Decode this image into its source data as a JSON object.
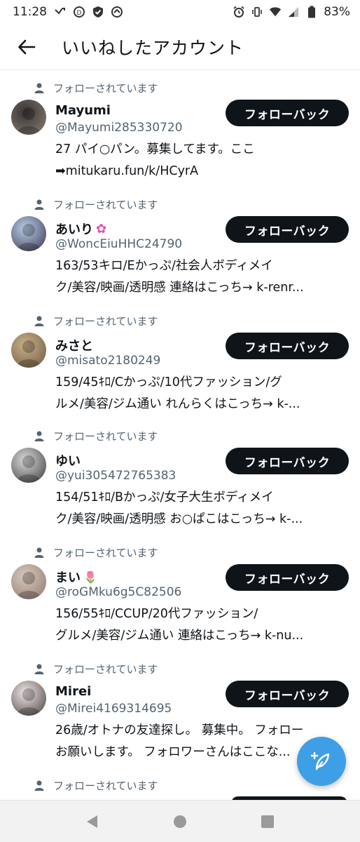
{
  "status_bar": {
    "time": "11:28",
    "battery": "83%"
  },
  "header": {
    "title": "いいねしたアカウント"
  },
  "follows_you_label": "フォローされています",
  "follow_back_label": "フォローバック",
  "accounts": [
    {
      "name": "Mayumi",
      "emoji": "",
      "handle": "@Mayumi285330720",
      "bio_lines": [
        "27 パイ○パン。募集してます。ここ",
        "➡mitukaru.fun/k/HCyrA"
      ],
      "avatar_colors": [
        "#3a3634",
        "#8a7f76"
      ]
    },
    {
      "name": "あいり",
      "emoji": "✿",
      "handle": "@WoncEiuHHC24790",
      "bio_lines": [
        "163/53キロ/Eかっぷ/社会人ボディメイ",
        "ク/美容/映画/透明感 連絡はこっち→ k-renr..."
      ],
      "avatar_colors": [
        "#b9cde6",
        "#3a3550"
      ]
    },
    {
      "name": "みさと",
      "emoji": "",
      "handle": "@misato2180249",
      "bio_lines": [
        "159/45ｷﾛ/Cかっぷ/10代ファッション/グ",
        "ルメ/美容/ジム通い れんらくはこっち→ k-..."
      ],
      "avatar_colors": [
        "#c9b089",
        "#6d5a45"
      ]
    },
    {
      "name": "ゆい",
      "emoji": "",
      "handle": "@yui305472765383",
      "bio_lines": [
        "154/51ｷﾛ/Bかっぷ/女子大生ボディメイ",
        "ク/美容/映画/透明感 お○ぱこはこっち→ k-..."
      ],
      "avatar_colors": [
        "#d9d9d9",
        "#3b3b3b"
      ]
    },
    {
      "name": "まい",
      "emoji": "🌷",
      "handle": "@roGMku6g5C82506",
      "bio_lines": [
        "156/55ｷﾛ/CCUP/20代ファッション/",
        "グルメ/美容/ジム通い 連絡はこっち→ k-nu..."
      ],
      "avatar_colors": [
        "#d8c8bd",
        "#8e7a6d"
      ]
    },
    {
      "name": "Mirei",
      "emoji": "",
      "handle": "@Mirei4169314695",
      "bio_lines": [
        "26歳/オトナの友達探し。 募集中。 フォロー",
        "お願いします。 フォロワーさんはここな..."
      ],
      "avatar_colors": [
        "#efe6e6",
        "#4a3d3d"
      ]
    }
  ],
  "colors": {
    "text": "#0f1419",
    "secondary": "#536471",
    "button_bg": "#0f1419",
    "fab": "#3f9fe6",
    "pink": "#e44fb3",
    "red": "#e23b3b"
  },
  "icons": {
    "back": "arrow-left-icon",
    "person": "person-icon",
    "fab": "compose-icon"
  }
}
